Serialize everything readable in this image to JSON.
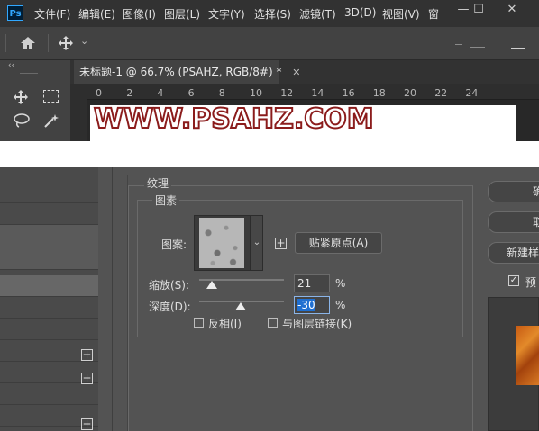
{
  "app": {
    "logo_text": "Ps"
  },
  "menu": [
    "文件(F)",
    "编辑(E)",
    "图像(I)",
    "图层(L)",
    "文字(Y)",
    "选择(S)",
    "滤镜(T)",
    "3D(D)",
    "视图(V)",
    "窗"
  ],
  "window_controls": {
    "minimize": "—",
    "restore": "☐",
    "close": "✕"
  },
  "options_bar": {
    "home_icon": "home-icon",
    "move_icon": "move-icon",
    "chevron": "⌄"
  },
  "tools_panel": {
    "collapse": "‹‹",
    "marker": "0"
  },
  "document_tab": {
    "title": "未标题-1 @ 66.7% (PSAHZ, RGB/8#) *",
    "close": "✕"
  },
  "ruler": {
    "ticks": [
      "0",
      "2",
      "4",
      "6",
      "8",
      "10",
      "12",
      "14",
      "16",
      "18",
      "20",
      "22",
      "24"
    ]
  },
  "canvas": {
    "watermark": "WWW.PSAHZ.COM"
  },
  "dialog": {
    "section_title": "纹理",
    "group_title": "图素",
    "pattern_label": "图案:",
    "snap_button": "贴紧原点(A)",
    "scale_label": "缩放(S):",
    "scale_value": "21",
    "scale_percent": 21,
    "depth_label": "深度(D):",
    "depth_value": "-30",
    "depth_percent": -30,
    "percent_sign": "%",
    "invert_label": "反相(I)",
    "link_label": "与图层链接(K)",
    "right_buttons": [
      "确",
      "取",
      "新建样"
    ],
    "preview_label": "预",
    "preview_checked": true
  },
  "style_list": {
    "plus": "+"
  }
}
